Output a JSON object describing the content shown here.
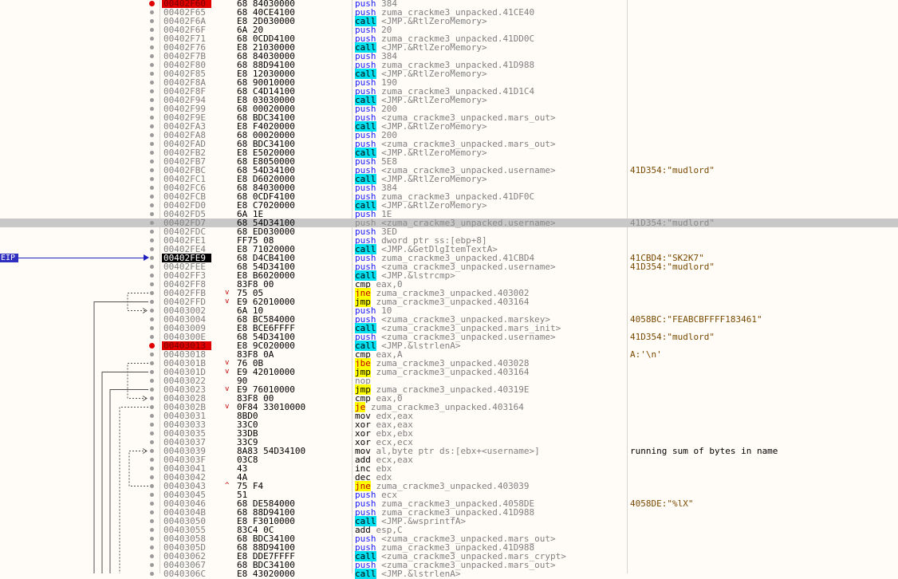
{
  "eip_label": "EIP",
  "rows": [
    {
      "addr": "00402F60",
      "bytes": "68 84030000",
      "mnem": "push",
      "kind": "push",
      "ops": "384",
      "comment": "",
      "dot": "red",
      "addr_style": "bp"
    },
    {
      "addr": "00402F65",
      "bytes": "68 40CE4100",
      "mnem": "push",
      "kind": "push",
      "ops": "zuma_crackme3_unpacked.41CE40",
      "comment": ""
    },
    {
      "addr": "00402F6A",
      "bytes": "E8 2D030000",
      "mnem": "call",
      "kind": "call",
      "ops": "<JMP.&RtlZeroMemory>",
      "comment": ""
    },
    {
      "addr": "00402F6F",
      "bytes": "6A 20",
      "mnem": "push",
      "kind": "push",
      "ops": "20",
      "comment": ""
    },
    {
      "addr": "00402F71",
      "bytes": "68 0CDD4100",
      "mnem": "push",
      "kind": "push",
      "ops": "zuma_crackme3_unpacked.41DD0C",
      "comment": ""
    },
    {
      "addr": "00402F76",
      "bytes": "E8 21030000",
      "mnem": "call",
      "kind": "call",
      "ops": "<JMP.&RtlZeroMemory>",
      "comment": ""
    },
    {
      "addr": "00402F7B",
      "bytes": "68 84030000",
      "mnem": "push",
      "kind": "push",
      "ops": "384",
      "comment": ""
    },
    {
      "addr": "00402F80",
      "bytes": "68 88D94100",
      "mnem": "push",
      "kind": "push",
      "ops": "zuma_crackme3_unpacked.41D988",
      "comment": ""
    },
    {
      "addr": "00402F85",
      "bytes": "E8 12030000",
      "mnem": "call",
      "kind": "call",
      "ops": "<JMP.&RtlZeroMemory>",
      "comment": ""
    },
    {
      "addr": "00402F8A",
      "bytes": "68 90010000",
      "mnem": "push",
      "kind": "push",
      "ops": "190",
      "comment": ""
    },
    {
      "addr": "00402F8F",
      "bytes": "68 C4D14100",
      "mnem": "push",
      "kind": "push",
      "ops": "zuma_crackme3_unpacked.41D1C4",
      "comment": ""
    },
    {
      "addr": "00402F94",
      "bytes": "E8 03030000",
      "mnem": "call",
      "kind": "call",
      "ops": "<JMP.&RtlZeroMemory>",
      "comment": ""
    },
    {
      "addr": "00402F99",
      "bytes": "68 00020000",
      "mnem": "push",
      "kind": "push",
      "ops": "200",
      "comment": ""
    },
    {
      "addr": "00402F9E",
      "bytes": "68 BDC34100",
      "mnem": "push",
      "kind": "push",
      "ops": "<zuma_crackme3_unpacked.mars_out>",
      "comment": ""
    },
    {
      "addr": "00402FA3",
      "bytes": "E8 F4020000",
      "mnem": "call",
      "kind": "call",
      "ops": "<JMP.&RtlZeroMemory>",
      "comment": ""
    },
    {
      "addr": "00402FA8",
      "bytes": "68 00020000",
      "mnem": "push",
      "kind": "push",
      "ops": "200",
      "comment": ""
    },
    {
      "addr": "00402FAD",
      "bytes": "68 BDC34100",
      "mnem": "push",
      "kind": "push",
      "ops": "<zuma_crackme3_unpacked.mars_out>",
      "comment": ""
    },
    {
      "addr": "00402FB2",
      "bytes": "E8 E5020000",
      "mnem": "call",
      "kind": "call",
      "ops": "<JMP.&RtlZeroMemory>",
      "comment": ""
    },
    {
      "addr": "00402FB7",
      "bytes": "68 E8050000",
      "mnem": "push",
      "kind": "push",
      "ops": "5E8",
      "comment": ""
    },
    {
      "addr": "00402FBC",
      "bytes": "68 54D34100",
      "mnem": "push",
      "kind": "push",
      "ops": "<zuma_crackme3_unpacked.username>",
      "comment": "41D354:\"mudlord\""
    },
    {
      "addr": "00402FC1",
      "bytes": "E8 D6020000",
      "mnem": "call",
      "kind": "call",
      "ops": "<JMP.&RtlZeroMemory>",
      "comment": ""
    },
    {
      "addr": "00402FC6",
      "bytes": "68 84030000",
      "mnem": "push",
      "kind": "push",
      "ops": "384",
      "comment": ""
    },
    {
      "addr": "00402FCB",
      "bytes": "68 0CDF4100",
      "mnem": "push",
      "kind": "push",
      "ops": "zuma_crackme3_unpacked.41DF0C",
      "comment": ""
    },
    {
      "addr": "00402FD0",
      "bytes": "E8 C7020000",
      "mnem": "call",
      "kind": "call",
      "ops": "<JMP.&RtlZeroMemory>",
      "comment": ""
    },
    {
      "addr": "00402FD5",
      "bytes": "6A 1E",
      "mnem": "push",
      "kind": "push",
      "ops": "1E",
      "comment": ""
    },
    {
      "addr": "00402FD7",
      "bytes": "68 54D34100",
      "mnem": "push",
      "kind": "push",
      "ops": "<zuma_crackme3_unpacked.username>",
      "comment": "41D354:\"mudlord\"",
      "highlight": true
    },
    {
      "addr": "00402FDC",
      "bytes": "68 ED030000",
      "mnem": "push",
      "kind": "push",
      "ops": "3ED",
      "comment": ""
    },
    {
      "addr": "00402FE1",
      "bytes": "FF75 08",
      "mnem": "push",
      "kind": "push",
      "ops": "dword ptr ss:[ebp+8]",
      "comment": ""
    },
    {
      "addr": "00402FE4",
      "bytes": "E8 71020000",
      "mnem": "call",
      "kind": "call",
      "ops": "<JMP.&GetDlgItemTextA>",
      "comment": ""
    },
    {
      "addr": "00402FE9",
      "bytes": "68 D4CB4100",
      "mnem": "push",
      "kind": "push",
      "ops": "zuma_crackme3_unpacked.41CBD4",
      "comment": "41CBD4:\"SK2K7\"",
      "addr_style": "eip"
    },
    {
      "addr": "00402FEE",
      "bytes": "68 54D34100",
      "mnem": "push",
      "kind": "push",
      "ops": "<zuma_crackme3_unpacked.username>",
      "comment": "41D354:\"mudlord\""
    },
    {
      "addr": "00402FF3",
      "bytes": "E8 B6020000",
      "mnem": "call",
      "kind": "call",
      "ops": "<JMP.&lstrcmp>",
      "comment": ""
    },
    {
      "addr": "00402FF8",
      "bytes": "83F8 00",
      "mnem": "cmp",
      "kind": "plain",
      "ops": "eax,0",
      "comment": ""
    },
    {
      "addr": "00402FFB",
      "bytes": "75 05",
      "mnem": "jne",
      "kind": "jcc",
      "ops": "zuma_crackme3_unpacked.403002",
      "comment": "",
      "arrow": "down"
    },
    {
      "addr": "00402FFD",
      "bytes": "E9 62010000",
      "mnem": "jmp",
      "kind": "jmp",
      "ops": "zuma_crackme3_unpacked.403164",
      "comment": "",
      "arrow": "down"
    },
    {
      "addr": "00403002",
      "bytes": "6A 10",
      "mnem": "push",
      "kind": "push",
      "ops": "10",
      "comment": ""
    },
    {
      "addr": "00403004",
      "bytes": "68 BC584000",
      "mnem": "push",
      "kind": "push",
      "ops": "<zuma_crackme3_unpacked.marskey>",
      "comment": "4058BC:\"FEABCBFFFF183461\""
    },
    {
      "addr": "00403009",
      "bytes": "E8 BCE6FFFF",
      "mnem": "call",
      "kind": "call",
      "ops": "<zuma_crackme3_unpacked.mars_init>",
      "comment": ""
    },
    {
      "addr": "0040300E",
      "bytes": "68 54D34100",
      "mnem": "push",
      "kind": "push",
      "ops": "<zuma_crackme3_unpacked.username>",
      "comment": "41D354:\"mudlord\""
    },
    {
      "addr": "00403013",
      "bytes": "E8 9C020000",
      "mnem": "call",
      "kind": "call",
      "ops": "<JMP.&lstrlenA>",
      "comment": "",
      "dot": "red",
      "addr_style": "bp"
    },
    {
      "addr": "00403018",
      "bytes": "83F8 0A",
      "mnem": "cmp",
      "kind": "plain",
      "ops": "eax,A",
      "comment": "A:'\\n'"
    },
    {
      "addr": "0040301B",
      "bytes": "76 0B",
      "mnem": "jbe",
      "kind": "jcc",
      "ops": "zuma_crackme3_unpacked.403028",
      "comment": "",
      "arrow": "down"
    },
    {
      "addr": "0040301D",
      "bytes": "E9 42010000",
      "mnem": "jmp",
      "kind": "jmp",
      "ops": "zuma_crackme3_unpacked.403164",
      "comment": "",
      "arrow": "down"
    },
    {
      "addr": "00403022",
      "bytes": "90",
      "mnem": "nop",
      "kind": "nop",
      "ops": "",
      "comment": ""
    },
    {
      "addr": "00403023",
      "bytes": "E9 76010000",
      "mnem": "jmp",
      "kind": "jmp",
      "ops": "zuma_crackme3_unpacked.40319E",
      "comment": "",
      "arrow": "down"
    },
    {
      "addr": "00403028",
      "bytes": "83F8 00",
      "mnem": "cmp",
      "kind": "plain",
      "ops": "eax,0",
      "comment": ""
    },
    {
      "addr": "0040302B",
      "bytes": "0F84 33010000",
      "mnem": "je",
      "kind": "jcc",
      "ops": "zuma_crackme3_unpacked.403164",
      "comment": "",
      "arrow": "down"
    },
    {
      "addr": "00403031",
      "bytes": "8BD0",
      "mnem": "mov",
      "kind": "plain",
      "ops": "edx,eax",
      "comment": ""
    },
    {
      "addr": "00403033",
      "bytes": "33C0",
      "mnem": "xor",
      "kind": "plain",
      "ops": "eax,eax",
      "comment": ""
    },
    {
      "addr": "00403035",
      "bytes": "33DB",
      "mnem": "xor",
      "kind": "plain",
      "ops": "ebx,ebx",
      "comment": ""
    },
    {
      "addr": "00403037",
      "bytes": "33C9",
      "mnem": "xor",
      "kind": "plain",
      "ops": "ecx,ecx",
      "comment": ""
    },
    {
      "addr": "00403039",
      "bytes": "8A83 54D34100",
      "mnem": "mov",
      "kind": "plain",
      "ops": "al,byte ptr ds:[ebx+<username>]",
      "comment": "running sum of bytes in name",
      "comment_black": true
    },
    {
      "addr": "0040303F",
      "bytes": "03C8",
      "mnem": "add",
      "kind": "plain",
      "ops": "ecx,eax",
      "comment": ""
    },
    {
      "addr": "00403041",
      "bytes": "43",
      "mnem": "inc",
      "kind": "plain",
      "ops": "ebx",
      "comment": ""
    },
    {
      "addr": "00403042",
      "bytes": "4A",
      "mnem": "dec",
      "kind": "plain",
      "ops": "edx",
      "comment": ""
    },
    {
      "addr": "00403043",
      "bytes": "75 F4",
      "mnem": "jne",
      "kind": "jcc",
      "ops": "zuma_crackme3_unpacked.403039",
      "comment": "",
      "arrow": "up"
    },
    {
      "addr": "00403045",
      "bytes": "51",
      "mnem": "push",
      "kind": "push",
      "ops": "ecx",
      "comment": ""
    },
    {
      "addr": "00403046",
      "bytes": "68 DE584000",
      "mnem": "push",
      "kind": "push",
      "ops": "zuma_crackme3_unpacked.4058DE",
      "comment": "4058DE:\"%lX\""
    },
    {
      "addr": "0040304B",
      "bytes": "68 88D94100",
      "mnem": "push",
      "kind": "push",
      "ops": "zuma_crackme3_unpacked.41D988",
      "comment": ""
    },
    {
      "addr": "00403050",
      "bytes": "E8 F3010000",
      "mnem": "call",
      "kind": "call",
      "ops": "<JMP.&wsprintfA>",
      "comment": ""
    },
    {
      "addr": "00403055",
      "bytes": "83C4 0C",
      "mnem": "add",
      "kind": "plain",
      "ops": "esp,C",
      "comment": ""
    },
    {
      "addr": "00403058",
      "bytes": "68 BDC34100",
      "mnem": "push",
      "kind": "push",
      "ops": "<zuma_crackme3_unpacked.mars_out>",
      "comment": ""
    },
    {
      "addr": "0040305D",
      "bytes": "68 88D94100",
      "mnem": "push",
      "kind": "push",
      "ops": "zuma_crackme3_unpacked.41D988",
      "comment": ""
    },
    {
      "addr": "00403062",
      "bytes": "E8 DDE7FFFF",
      "mnem": "call",
      "kind": "call",
      "ops": "<zuma_crackme3_unpacked.mars_crypt>",
      "comment": ""
    },
    {
      "addr": "00403067",
      "bytes": "68 BDC34100",
      "mnem": "push",
      "kind": "push",
      "ops": "<zuma_crackme3_unpacked.mars_out>",
      "comment": ""
    },
    {
      "addr": "0040306C",
      "bytes": "E8 43020000",
      "mnem": "call",
      "kind": "call",
      "ops": "<JMP.&lstrlenA>",
      "comment": ""
    }
  ]
}
